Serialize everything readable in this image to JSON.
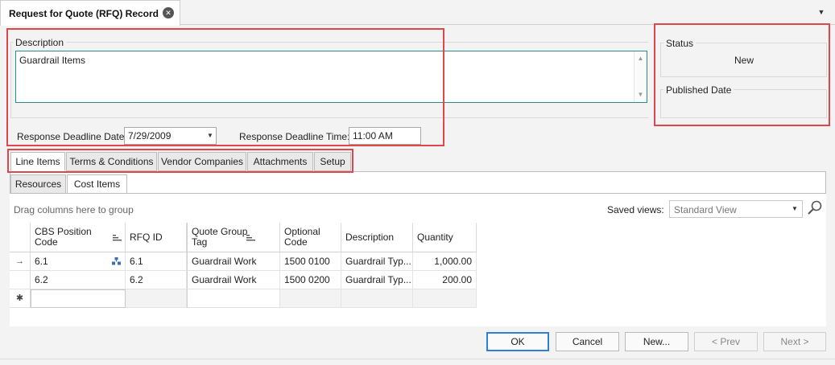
{
  "window": {
    "tab_title": "Request for Quote (RFQ) Record"
  },
  "header": {
    "description_label": "Description",
    "description_value": "Guardrail Items",
    "response_deadline_date_label": "Response Deadline Date:",
    "response_deadline_date_value": "7/29/2009",
    "response_deadline_time_label": "Response Deadline Time:",
    "response_deadline_time_value": "11:00 AM",
    "status_label": "Status",
    "status_value": "New",
    "published_date_label": "Published Date",
    "published_date_value": ""
  },
  "tabs": [
    {
      "label": "Line Items",
      "active": true
    },
    {
      "label": "Terms & Conditions",
      "active": false
    },
    {
      "label": "Vendor Companies",
      "active": false
    },
    {
      "label": "Attachments",
      "active": false
    },
    {
      "label": "Setup",
      "active": false
    }
  ],
  "subtabs": [
    {
      "label": "Resources",
      "active": false
    },
    {
      "label": "Cost Items",
      "active": true
    }
  ],
  "grid": {
    "group_hint": "Drag columns here to group",
    "saved_views_label": "Saved views:",
    "saved_views_placeholder": "Standard View",
    "columns": [
      {
        "label": "CBS Position Code"
      },
      {
        "label": "RFQ ID"
      },
      {
        "label": "Quote Group Tag"
      },
      {
        "label": "Optional Code"
      },
      {
        "label": "Description"
      },
      {
        "label": "Quantity"
      }
    ],
    "rows": [
      {
        "cbs": "6.1",
        "rfq_id": "6.1",
        "group_tag": "Guardrail Work",
        "optional_code": "1500 0100",
        "description": "Guardrail Typ...",
        "quantity": "1,000.00",
        "current": true
      },
      {
        "cbs": "6.2",
        "rfq_id": "6.2",
        "group_tag": "Guardrail Work",
        "optional_code": "1500 0200",
        "description": "Guardrail Typ...",
        "quantity": "200.00",
        "current": false
      }
    ],
    "current_row_glyph": "→",
    "new_row_glyph": "✱"
  },
  "buttons": {
    "ok": "OK",
    "cancel": "Cancel",
    "new": "New...",
    "prev": "< Prev",
    "next": "Next >"
  },
  "colors": {
    "highlight": "#e0474c",
    "focus": "#2f7ed8",
    "description_border": "#2b8a8a"
  },
  "icons": {
    "close": "close-icon",
    "menu": "chevron-down-icon",
    "search": "search-icon",
    "hierarchy": "hierarchy-icon",
    "sort": "sort-icon"
  }
}
